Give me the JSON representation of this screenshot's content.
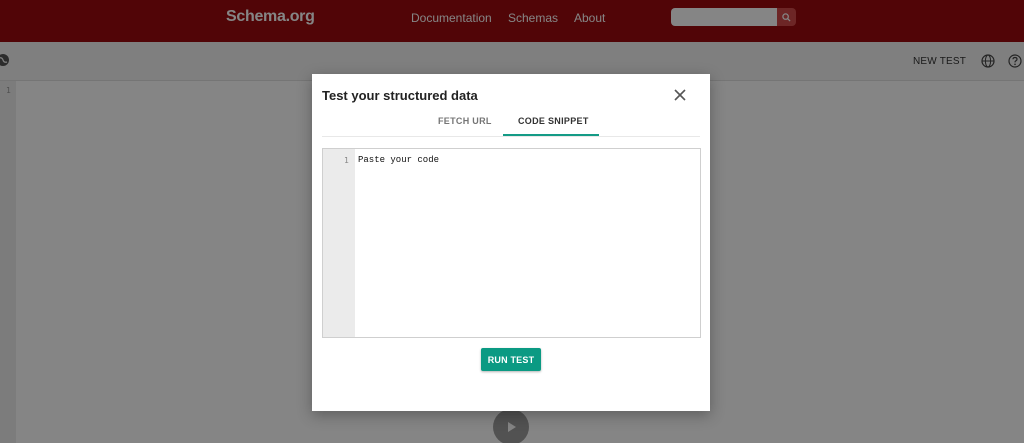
{
  "nav": {
    "brand": "Schema.org",
    "links": [
      "Documentation",
      "Schemas",
      "About"
    ],
    "search_placeholder": "",
    "search_icon": "search-icon"
  },
  "toolbar": {
    "new_test_label": "NEW TEST",
    "icons": [
      "globe-icon",
      "help-icon"
    ]
  },
  "editor": {
    "line_number": "1"
  },
  "modal": {
    "title": "Test your structured data",
    "tabs": [
      {
        "label": "FETCH URL",
        "active": false
      },
      {
        "label": "CODE SNIPPET",
        "active": true
      }
    ],
    "code": {
      "line_number": "1",
      "placeholder": "Paste your code"
    },
    "run_button": "RUN TEST",
    "close_icon": "close-icon"
  },
  "colors": {
    "brand_red": "#9b0b0e",
    "accent_teal": "#0b9a83"
  }
}
